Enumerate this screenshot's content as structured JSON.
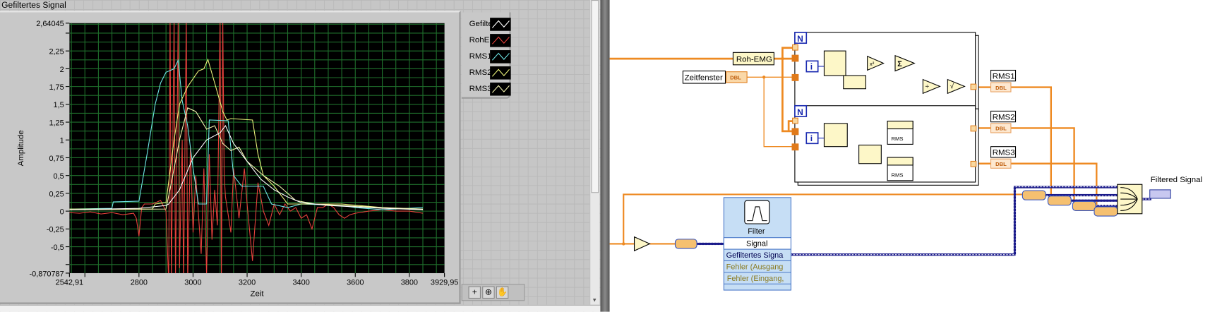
{
  "front_panel": {
    "graph_title": "Gefiltertes Signal",
    "legend": [
      {
        "name": "Gefiltert",
        "color": "#ffffff"
      },
      {
        "name": "RohEMG",
        "color": "#e8413c"
      },
      {
        "name": "RMS1",
        "color": "#6ee6e6"
      },
      {
        "name": "RMS2",
        "color": "#eaf27a"
      },
      {
        "name": "RMS3",
        "color": "#f4f4b0"
      }
    ],
    "tools": [
      {
        "icon": "cursor-icon",
        "glyph": "+"
      },
      {
        "icon": "zoom-icon",
        "glyph": "⊕"
      },
      {
        "icon": "pan-hand-icon",
        "glyph": "✋"
      }
    ]
  },
  "chart_data": {
    "type": "line",
    "title": "Gefiltertes Signal",
    "xlabel": "Zeit",
    "ylabel": "Amplitude",
    "xlim": [
      2542.91,
      3929.95
    ],
    "ylim": [
      -0.870787,
      2.64045
    ],
    "x_ticks": [
      {
        "v": 2542.91,
        "label": "2542,91"
      },
      {
        "v": 2600,
        "label": ""
      },
      {
        "v": 2800,
        "label": "2800"
      },
      {
        "v": 3000,
        "label": "3000"
      },
      {
        "v": 3200,
        "label": "3200"
      },
      {
        "v": 3400,
        "label": "3400"
      },
      {
        "v": 3600,
        "label": "3600"
      },
      {
        "v": 3800,
        "label": "3800"
      },
      {
        "v": 3929.95,
        "label": "3929,95"
      }
    ],
    "y_ticks": [
      {
        "v": 2.64045,
        "label": "2,64045"
      },
      {
        "v": 2.5,
        "label": ""
      },
      {
        "v": 2.25,
        "label": "2,25"
      },
      {
        "v": 2,
        "label": "2"
      },
      {
        "v": 1.75,
        "label": "1,75"
      },
      {
        "v": 1.5,
        "label": "1,5"
      },
      {
        "v": 1.25,
        "label": "1,25"
      },
      {
        "v": 1,
        "label": "1"
      },
      {
        "v": 0.75,
        "label": "0,75"
      },
      {
        "v": 0.5,
        "label": "0,5"
      },
      {
        "v": 0.25,
        "label": "0,25"
      },
      {
        "v": 0,
        "label": "0"
      },
      {
        "v": -0.25,
        "label": "-0,25"
      },
      {
        "v": -0.5,
        "label": "-0,5"
      },
      {
        "v": -0.75,
        "label": ""
      },
      {
        "v": -0.870787,
        "label": "-0,870787"
      }
    ],
    "grid": true,
    "legend_position": "top-right",
    "series": [
      {
        "name": "RohEMG",
        "color": "#e8413c",
        "x": [
          2543,
          2580,
          2620,
          2660,
          2700,
          2740,
          2780,
          2790,
          2800,
          2810,
          2820,
          2850,
          2880,
          2900,
          2910,
          2915,
          2920,
          2930,
          2935,
          2945,
          2950,
          2960,
          2965,
          2975,
          2980,
          2990,
          3000,
          3010,
          3030,
          3040,
          3050,
          3060,
          3070,
          3080,
          3090,
          3100,
          3105,
          3110,
          3115,
          3120,
          3140,
          3150,
          3170,
          3190,
          3200,
          3220,
          3240,
          3260,
          3280,
          3300,
          3320,
          3340,
          3360,
          3380,
          3400,
          3420,
          3440,
          3460,
          3480,
          3500,
          3520,
          3540,
          3560,
          3580,
          3600,
          3650,
          3700,
          3750,
          3800,
          3850
        ],
        "y": [
          -0.02,
          -0.03,
          -0.01,
          -0.04,
          -0.02,
          -0.05,
          -0.03,
          -0.1,
          -0.35,
          0.05,
          0.1,
          0.1,
          0.15,
          0.0,
          -1.0,
          2.7,
          -1.0,
          2.7,
          -1.0,
          2.7,
          -0.8,
          1.0,
          -1.0,
          2.7,
          -1.0,
          0.9,
          -0.3,
          0.5,
          -0.6,
          0.6,
          -0.9,
          0.8,
          -0.4,
          0.3,
          -0.2,
          2.7,
          -1.0,
          2.7,
          0.5,
          0.2,
          -0.3,
          0.6,
          -0.1,
          0.6,
          0.1,
          -0.7,
          0.4,
          0.0,
          -0.2,
          0.1,
          -0.05,
          0.1,
          0.0,
          0.05,
          -0.1,
          -0.05,
          -0.25,
          0.05,
          0.05,
          0.1,
          0.05,
          -0.05,
          -0.1,
          -0.05,
          -0.03,
          0.0,
          0.02,
          0.0,
          0.0,
          -0.03
        ]
      },
      {
        "name": "RMS1",
        "color": "#6ee6e6",
        "x": [
          2543,
          2700,
          2705,
          2800,
          2830,
          2860,
          2880,
          2900,
          2930,
          2945,
          2960,
          2980,
          3000,
          3020,
          3050,
          3060,
          3130,
          3150,
          3180,
          3260,
          3290,
          3350,
          3400,
          3550,
          3600,
          3700,
          3850
        ],
        "y": [
          0.03,
          0.04,
          0.13,
          0.14,
          0.8,
          1.5,
          1.8,
          1.95,
          2.0,
          2.12,
          1.55,
          1.2,
          0.6,
          0.1,
          0.1,
          1.28,
          1.27,
          0.5,
          0.35,
          0.35,
          0.1,
          0.05,
          0.1,
          0.08,
          0.05,
          0.02,
          0.05
        ]
      },
      {
        "name": "RMS2",
        "color": "#eaf27a",
        "x": [
          2543,
          2850,
          2860,
          2900,
          2930,
          2950,
          2980,
          3020,
          3040,
          3055,
          3080,
          3110,
          3125,
          3140,
          3220,
          3240,
          3260,
          3300,
          3350,
          3400,
          3550,
          3700,
          3850
        ],
        "y": [
          0.03,
          0.03,
          0.1,
          0.12,
          1.0,
          1.5,
          1.75,
          1.97,
          2.0,
          2.13,
          1.8,
          1.4,
          1.28,
          1.3,
          1.28,
          0.8,
          0.5,
          0.35,
          0.1,
          0.1,
          0.1,
          0.05,
          0.02
        ]
      },
      {
        "name": "RMS3",
        "color": "#f4f4b0",
        "x": [
          2543,
          2900,
          2920,
          2950,
          2980,
          3010,
          3050,
          3080,
          3110,
          3140,
          3170,
          3200,
          3260,
          3320,
          3380,
          3450,
          3550,
          3700,
          3850
        ],
        "y": [
          0.02,
          0.03,
          0.4,
          1.0,
          1.45,
          1.4,
          1.15,
          1.2,
          0.95,
          0.85,
          0.9,
          0.7,
          0.5,
          0.35,
          0.15,
          0.1,
          0.08,
          0.05,
          0.03
        ]
      },
      {
        "name": "Gefiltert",
        "color": "#ffffff",
        "x": [
          2543,
          2800,
          2900,
          2910,
          2950,
          3000,
          3050,
          3100,
          3120,
          3150,
          3200,
          3250,
          3300,
          3350,
          3400,
          3500,
          3600,
          3700,
          3850
        ],
        "y": [
          0.02,
          0.04,
          0.08,
          0.1,
          0.3,
          0.75,
          1.0,
          1.1,
          1.2,
          0.95,
          0.7,
          0.45,
          0.3,
          0.2,
          0.12,
          0.08,
          0.06,
          0.04,
          0.02
        ]
      }
    ]
  },
  "block_diagram": {
    "roh_emg": "Roh-EMG",
    "zeitfenster": "Zeitfenster",
    "dbl": "DBL",
    "loop_count": "N",
    "loop_index": "i",
    "rms_node": "RMS",
    "rms1": "RMS1",
    "rms2": "RMS2",
    "rms3": "RMS3",
    "filtered_signal": "Filtered Signal",
    "filter": {
      "title": "Filter",
      "rows": [
        "Signal",
        "Gefiltertes Signa",
        "Fehler (Ausgang",
        "Fehler (Eingang,"
      ]
    }
  }
}
